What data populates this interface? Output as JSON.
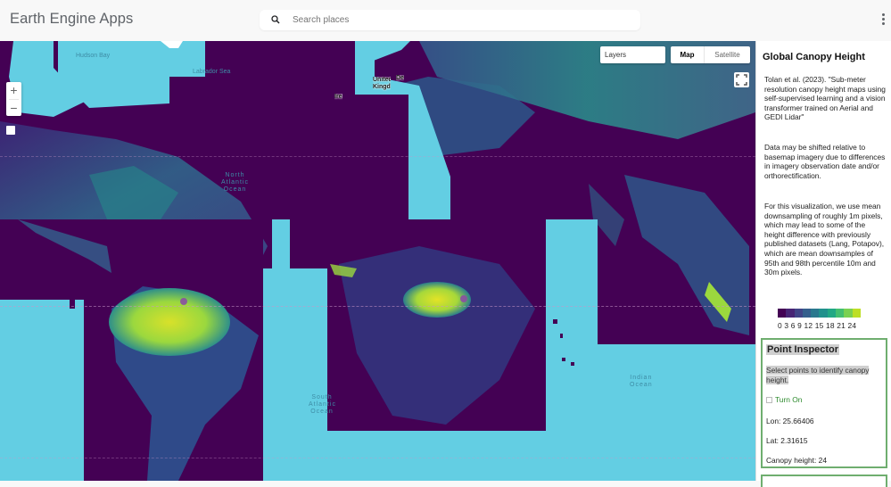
{
  "header": {
    "app_title": "Earth Engine Apps",
    "search": {
      "placeholder": "Search places",
      "value": ""
    },
    "menu_icon": "more-vert-icon"
  },
  "map": {
    "controls": {
      "zoom_in": "+",
      "zoom_out": "−",
      "layers_label": "Layers",
      "map_type": {
        "options": [
          "Map",
          "Satellite"
        ],
        "selected": "Map"
      },
      "fullscreen_icon": "fullscreen-icon"
    },
    "labels": {
      "hudson_bay": "Hudson Bay",
      "labrador_sea": "Labrador Sea",
      "north_atlantic": [
        "North",
        "Atlantic",
        "Ocean"
      ],
      "south_atlantic": [
        "South",
        "Atlantic",
        "Ocean"
      ],
      "indian_ocean": [
        "Indian",
        "Ocean"
      ],
      "ireland": "Ireland",
      "united_kingdom": [
        "United",
        "Kingdom"
      ],
      "denmark": "Denmark"
    },
    "colors": {
      "water": "#63cee3",
      "no_data": "#440154"
    }
  },
  "panel": {
    "title": "Global Canopy Height",
    "citation": "Tolan et al. (2023). \"Sub-meter resolution canopy height maps using self-supervised learning and a vision transformer trained on Aerial and GEDI Lidar\"",
    "note_shift": "Data may be shifted relative to basemap imagery due to differences in imagery observation date and/or orthorectification.",
    "note_downsampling": "For this visualization, we use mean downsampling of roughly 1m pixels, which may lead to some of the height difference with previously published datasets (Lang, Potapov), which are mean downsamples of 95th and 98th percentile 10m and 30m pixels.",
    "legend": {
      "labels": "0 3 6 9 12 15 18 21 24",
      "ticks": [
        0,
        3,
        6,
        9,
        12,
        15,
        18,
        21,
        24
      ],
      "colors": [
        "#440154",
        "#482475",
        "#414487",
        "#355f8d",
        "#2a788e",
        "#21918c",
        "#22a884",
        "#44bf70",
        "#7ad151",
        "#bddf26"
      ]
    },
    "inspector": {
      "title": "Point Inspector",
      "description": "Select points to identify canopy height.",
      "toggle_label": "Turn On",
      "toggle_checked": false,
      "lon_label": "Lon: 25.66406",
      "lat_label": "Lat: 2.31615",
      "canopy_label": "Canopy height: 24",
      "accent_color": "#6fae6f"
    }
  }
}
